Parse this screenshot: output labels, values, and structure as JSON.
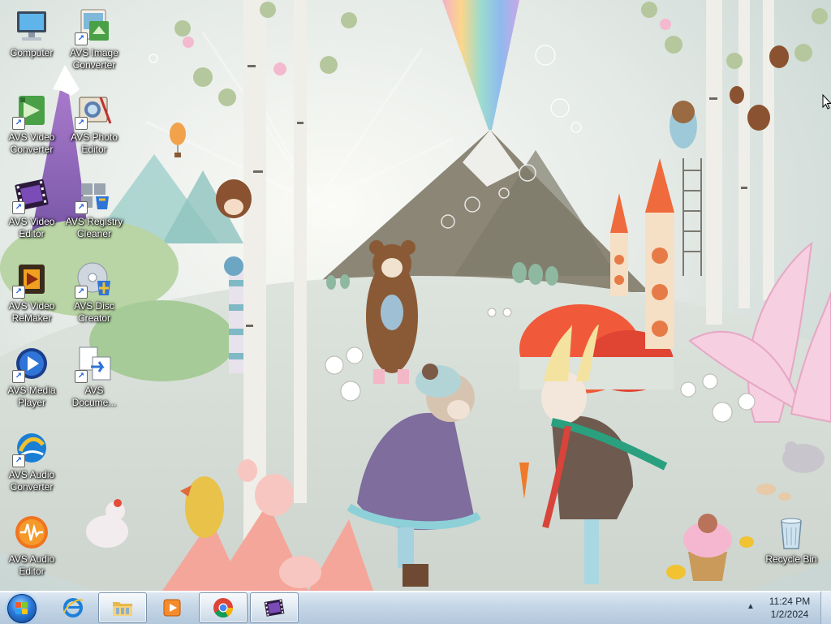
{
  "desktop": {
    "icons": [
      {
        "label": "Computer"
      },
      {
        "label": "AVS Image Converter"
      },
      {
        "label": "AVS Video Converter"
      },
      {
        "label": "AVS Photo Editor"
      },
      {
        "label": "AVS Video Editor"
      },
      {
        "label": "AVS Registry Cleaner"
      },
      {
        "label": "AVS Video ReMaker"
      },
      {
        "label": "AVS Disc Creator"
      },
      {
        "label": "AVS Media Player"
      },
      {
        "label": "AVS Docume..."
      },
      {
        "label": "AVS Audio Converter"
      },
      {
        "label": "AVS Audio Editor"
      },
      {
        "label": "Recycle Bin"
      }
    ]
  },
  "taskbar": {
    "start": {
      "icon": "windows-start-orb"
    },
    "items": [
      {
        "name": "Internet Explorer",
        "icon": "internet-explorer-icon",
        "state": "pinned"
      },
      {
        "name": "Windows Explorer",
        "icon": "folder-icon",
        "state": "running"
      },
      {
        "name": "Windows Media Player",
        "icon": "media-player-icon",
        "state": "pinned"
      },
      {
        "name": "Google Chrome",
        "icon": "chrome-icon",
        "state": "running"
      },
      {
        "name": "AVS Video Editor",
        "icon": "film-strip-icon",
        "state": "running"
      }
    ],
    "clock": {
      "time": "11:24 PM",
      "date": "1/2/2024"
    }
  },
  "colors": {
    "taskbar_top": "#dfe9f3",
    "taskbar_bottom": "#b3c8dc",
    "wallpaper_sky": "#e6ecea"
  }
}
